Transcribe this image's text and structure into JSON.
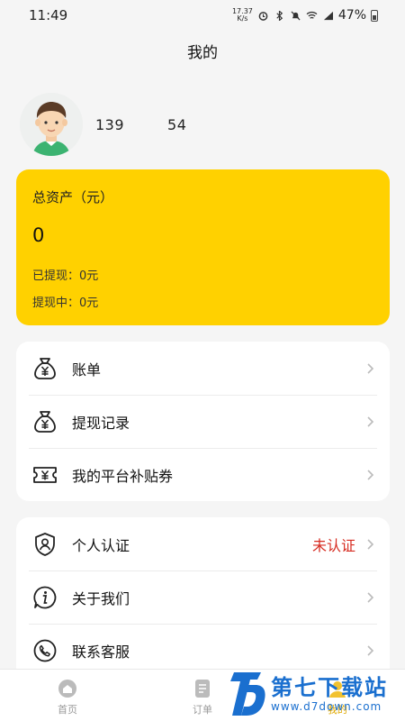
{
  "status_bar": {
    "time": "11:49",
    "speed_value": "17.37",
    "speed_unit": "K/s",
    "battery": "47%"
  },
  "header": {
    "title": "我的"
  },
  "profile": {
    "phone_prefix": "139",
    "phone_suffix": "54"
  },
  "assets": {
    "title": "总资产（元）",
    "total": "0",
    "withdrawn": "已提现：0元",
    "withdrawing": "提现中：0元"
  },
  "menu_group_1": [
    {
      "label": "账单",
      "icon": "money-bag-icon"
    },
    {
      "label": "提现记录",
      "icon": "money-bag-icon"
    },
    {
      "label": "我的平台补贴券",
      "icon": "coupon-icon"
    }
  ],
  "menu_group_2": [
    {
      "label": "个人认证",
      "icon": "shield-user-icon",
      "status": "未认证"
    },
    {
      "label": "关于我们",
      "icon": "info-icon"
    },
    {
      "label": "联系客服",
      "icon": "phone-icon"
    }
  ],
  "tabbar": [
    {
      "label": "首页",
      "icon": "home-icon"
    },
    {
      "label": "订单",
      "icon": "order-icon"
    },
    {
      "label": "我的",
      "icon": "mine-icon",
      "active": true
    }
  ],
  "watermark": {
    "main": "第七下载站",
    "sub": "www.d7down.com"
  },
  "colors": {
    "accent": "#ffd100",
    "warning": "#d62b20",
    "watermark": "#1a6fcf"
  }
}
